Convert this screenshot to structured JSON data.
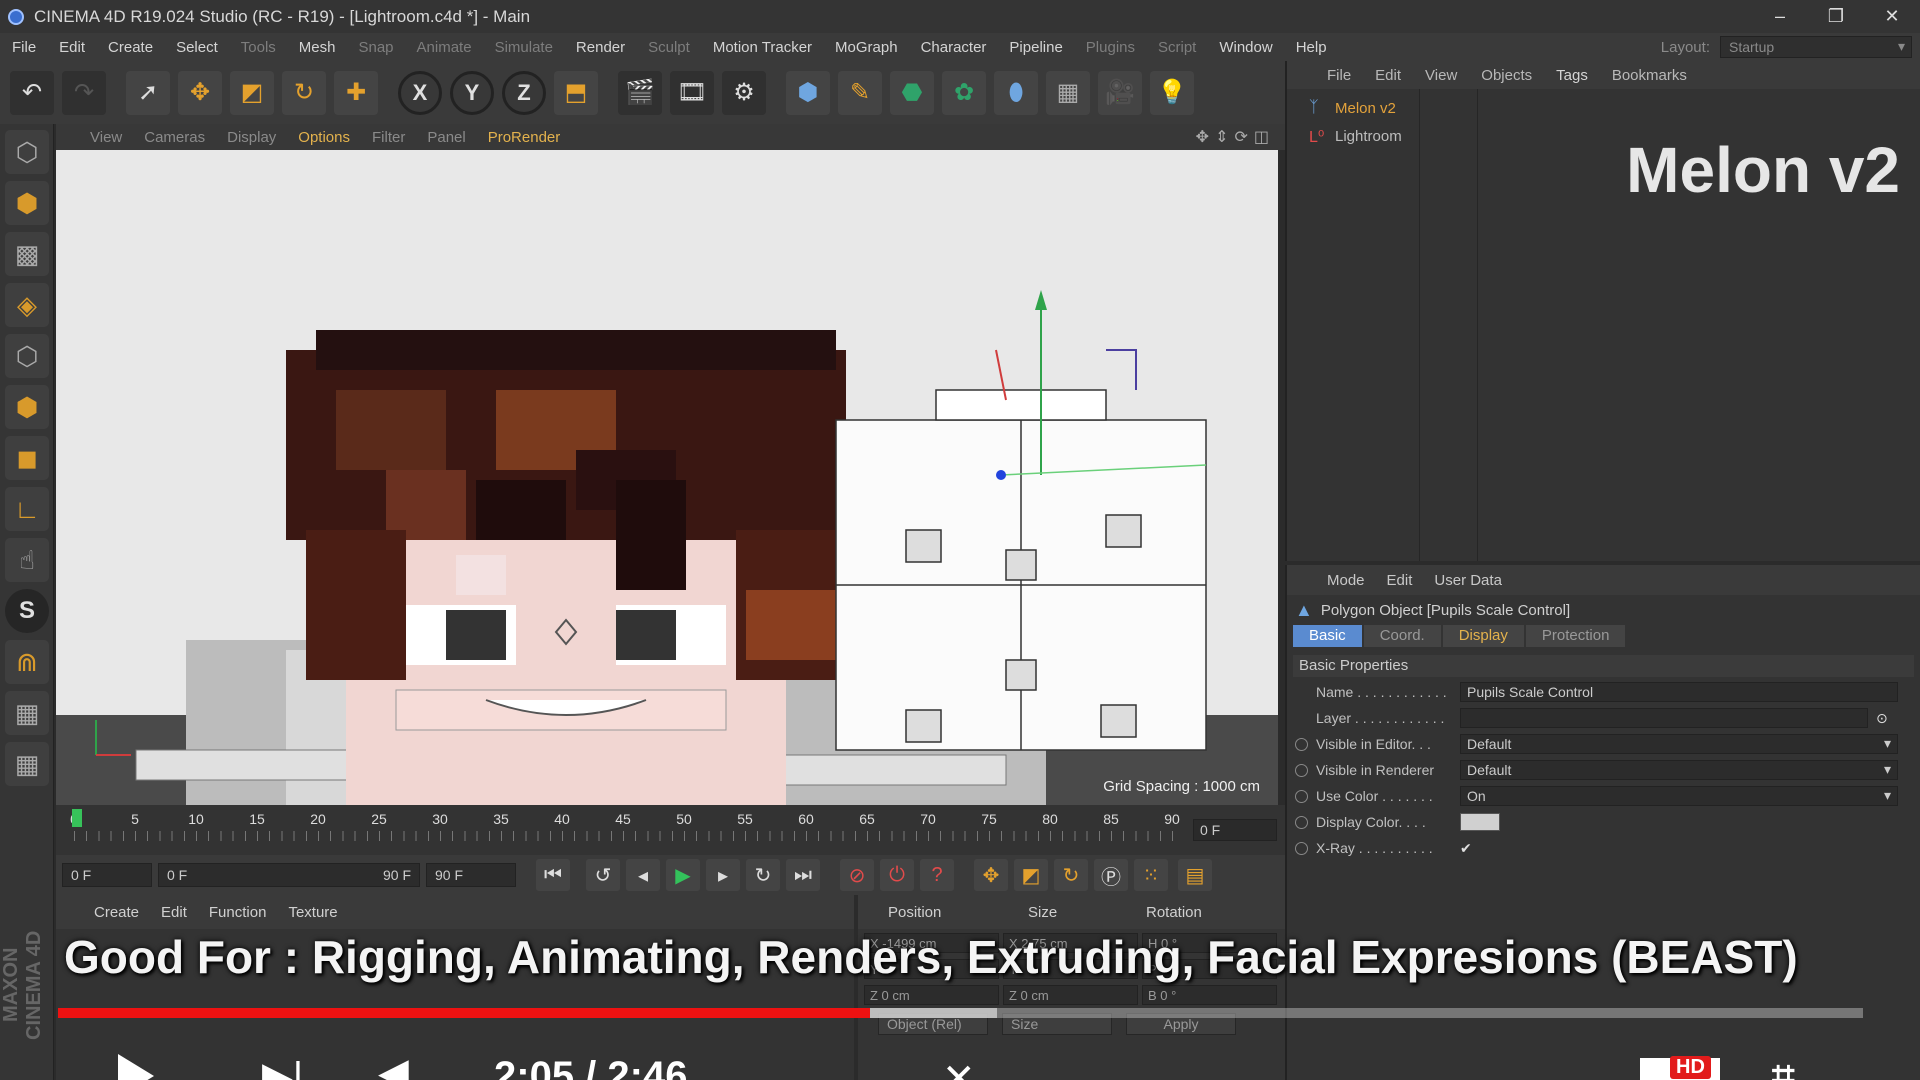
{
  "window": {
    "title": "CINEMA 4D R19.024 Studio (RC - R19) - [Lightroom.c4d *] - Main",
    "controls": [
      "–",
      "❐",
      "✕"
    ]
  },
  "menubar": {
    "items": [
      "File",
      "Edit",
      "Create",
      "Select",
      "Tools",
      "Mesh",
      "Snap",
      "Animate",
      "Simulate",
      "Render",
      "Sculpt",
      "Motion Tracker",
      "MoGraph",
      "Character",
      "Pipeline",
      "Plugins",
      "Script",
      "Window",
      "Help"
    ],
    "dim_items": [
      "Tools",
      "Snap",
      "Animate",
      "Simulate",
      "Sculpt",
      "Plugins",
      "Script"
    ],
    "layout_label": "Layout:",
    "layout_value": "Startup"
  },
  "toolbar": {
    "axis_x": "X",
    "axis_y": "Y",
    "axis_z": "Z"
  },
  "viewport": {
    "menu": [
      "View",
      "Cameras",
      "Display",
      "Options",
      "Filter",
      "Panel",
      "ProRender"
    ],
    "highlighted": [
      "Options",
      "ProRender"
    ],
    "grid_spacing": "Grid Spacing : 1000 cm"
  },
  "timeline": {
    "ticks": [
      "0",
      "5",
      "10",
      "15",
      "20",
      "25",
      "30",
      "35",
      "40",
      "45",
      "50",
      "55",
      "60",
      "65",
      "70",
      "75",
      "80",
      "85",
      "90"
    ],
    "current_frame": "0 F"
  },
  "transport": {
    "start_field": "0 F",
    "range_start": "0 F",
    "range_end": "90 F",
    "end_field": "90 F"
  },
  "material_panel": {
    "menu": [
      "Create",
      "Edit",
      "Function",
      "Texture"
    ]
  },
  "coord_panel": {
    "headers": [
      "Position",
      "Size",
      "Rotation"
    ],
    "rows": [
      [
        "X  -1499 cm",
        "X  2.75 cm",
        "H  0 °"
      ],
      [
        "Y  ",
        "Y  ",
        "P  "
      ],
      [
        "Z  0 cm",
        "Z  0 cm",
        "B  0 °"
      ]
    ],
    "mode_select": "Object (Rel)",
    "size_select": "Size",
    "apply_label": "Apply"
  },
  "object_manager": {
    "menu": [
      "File",
      "Edit",
      "View",
      "Objects",
      "Tags",
      "Bookmarks"
    ],
    "objects": [
      {
        "name": "Melon v2",
        "color": "#e3a23b"
      },
      {
        "name": "Lightroom",
        "color": "#bdbdbd"
      }
    ],
    "overlay_title": "Melon v2"
  },
  "attribute_manager": {
    "menu": [
      "Mode",
      "Edit",
      "User Data"
    ],
    "object_title": "Polygon Object [Pupils Scale Control]",
    "tabs": [
      "Basic",
      "Coord.",
      "Display",
      "Protection"
    ],
    "section": "Basic Properties",
    "fields": [
      {
        "label": "Name . . . . . . . . . . . .",
        "value": "Pupils Scale Control"
      },
      {
        "label": "Layer . . . . . . . . . . . .",
        "value": ""
      },
      {
        "label": "Visible in Editor. . .",
        "value": "Default"
      },
      {
        "label": "Visible in Renderer",
        "value": "Default"
      },
      {
        "label": "Use Color . . . . . . .",
        "value": "On"
      },
      {
        "label": "Display Color. . . .",
        "value": ""
      },
      {
        "label": "X-Ray . . . . . . . . . .",
        "value": "✔"
      }
    ]
  },
  "video_overlay": {
    "caption": "Good For : Rigging, Animating, Renders, Extruding, Facial Expresions (BEAST)",
    "progress_played": 0.45,
    "progress_buffered": 0.52,
    "time_display": "2:05 / 2:46",
    "hd_badge": "HD",
    "brand": "MAXON CINEMA 4D"
  },
  "colors": {
    "accent_orange": "#e3a23b",
    "accent_blue": "#5a8bd0",
    "progress_red": "#ee1111"
  }
}
